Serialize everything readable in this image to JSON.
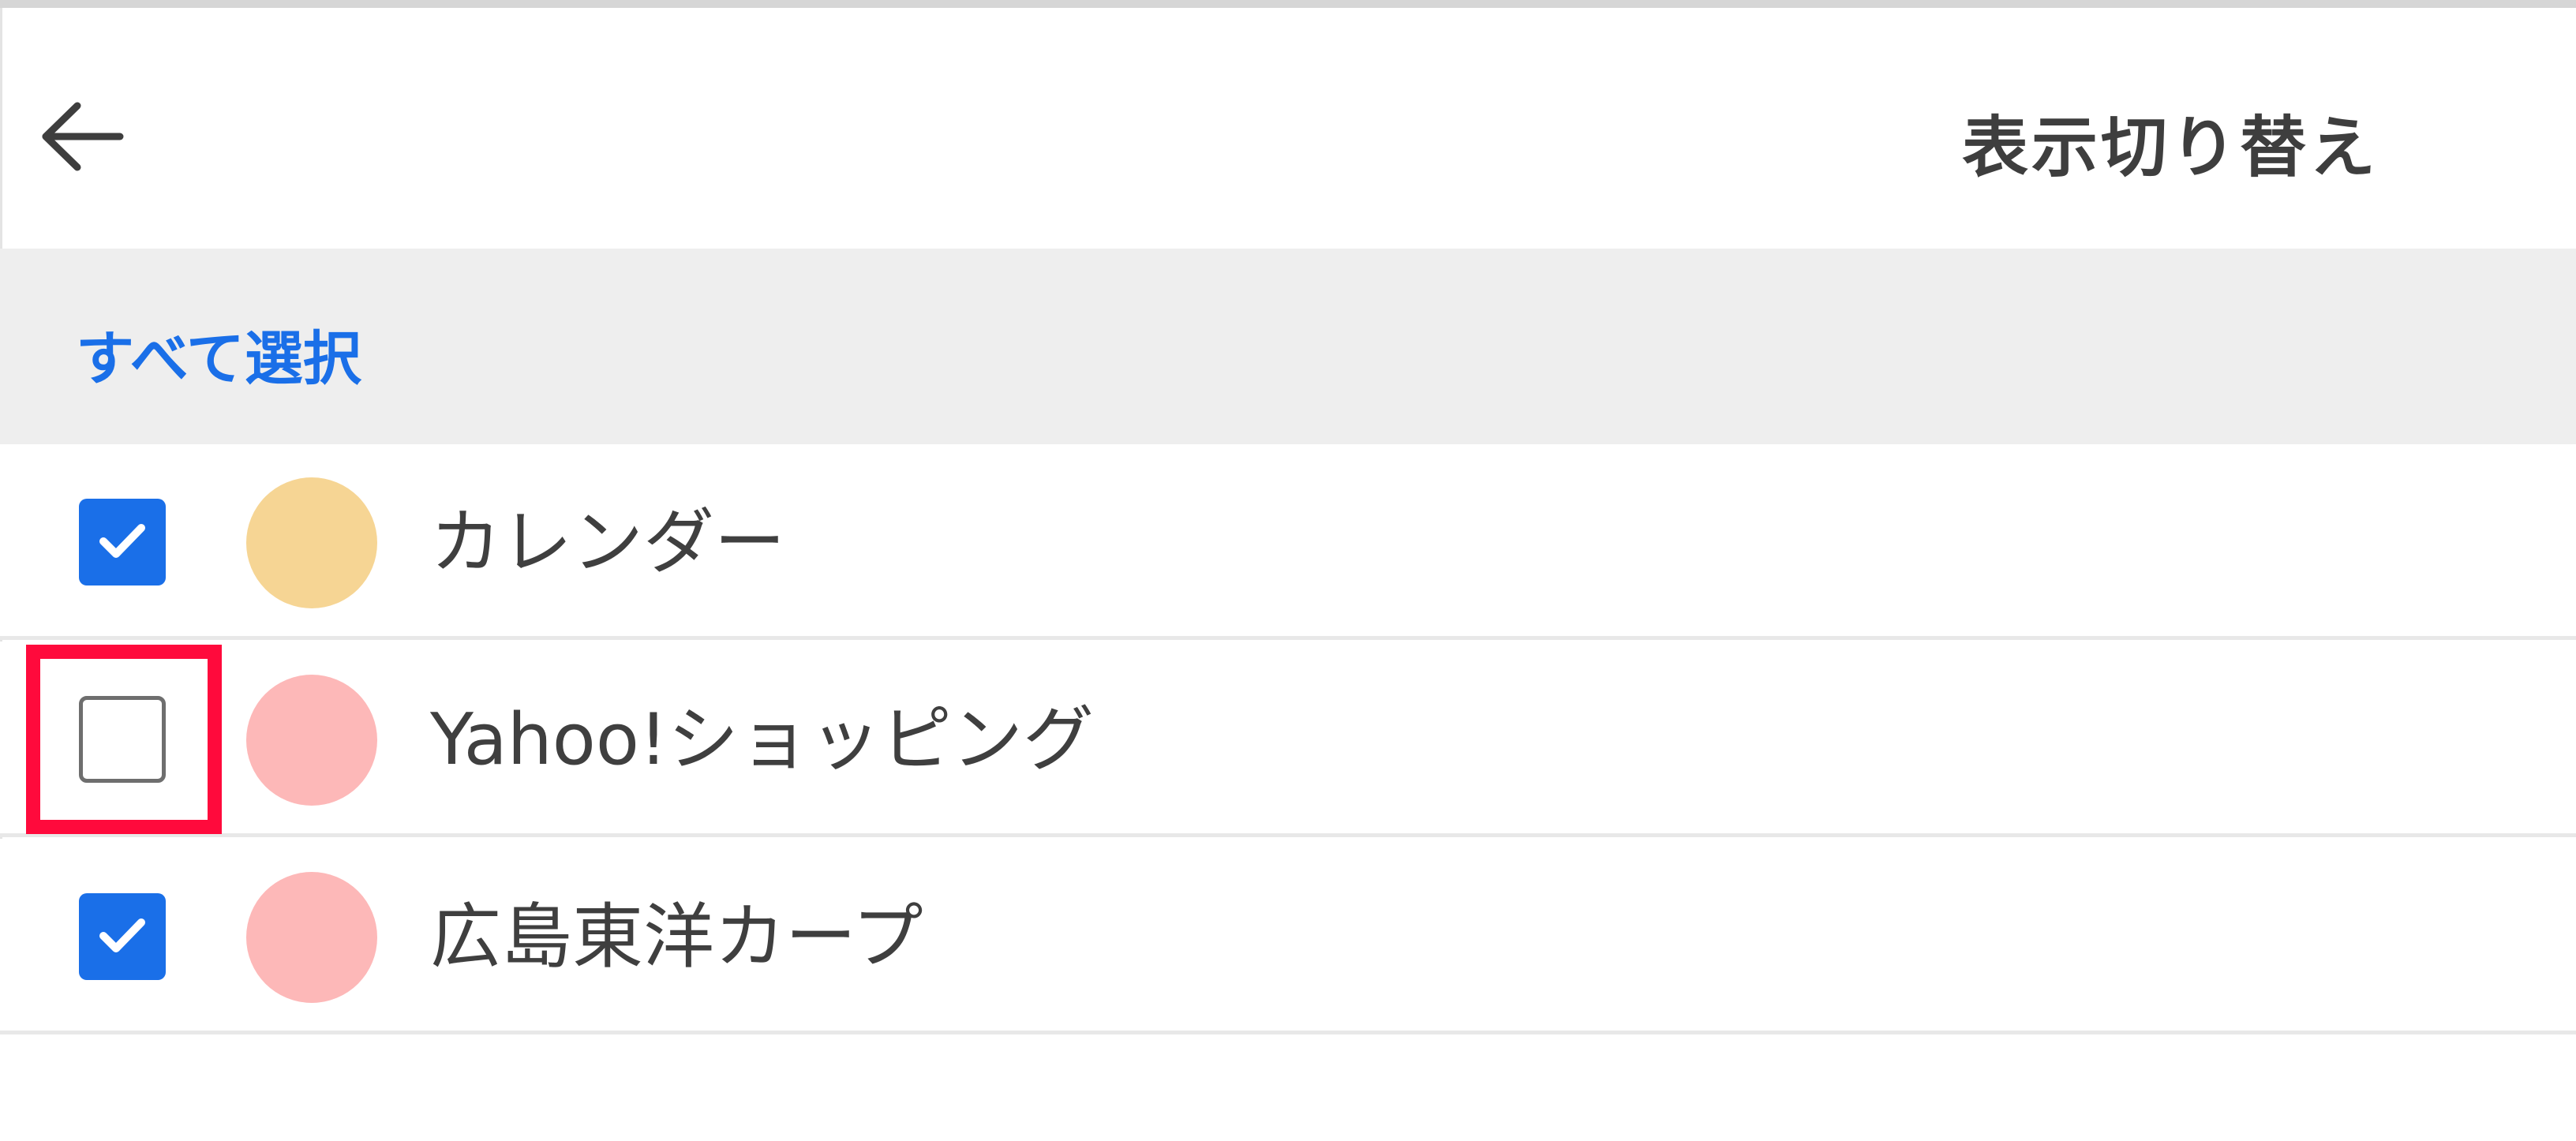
{
  "header": {
    "back_icon": "back-arrow-icon",
    "title": "表示切り替え"
  },
  "select_all": {
    "label": "すべて選択"
  },
  "colors": {
    "accent": "#1a6fe8",
    "highlight": "#ff0a3c"
  },
  "items": [
    {
      "label": "カレンダー",
      "checked": true,
      "dot_color": "#f6d594"
    },
    {
      "label": "Yahoo!ショッピング",
      "checked": false,
      "dot_color": "#fdb8b8",
      "highlighted": true
    },
    {
      "label": "広島東洋カープ",
      "checked": true,
      "dot_color": "#fdb8b8"
    }
  ]
}
